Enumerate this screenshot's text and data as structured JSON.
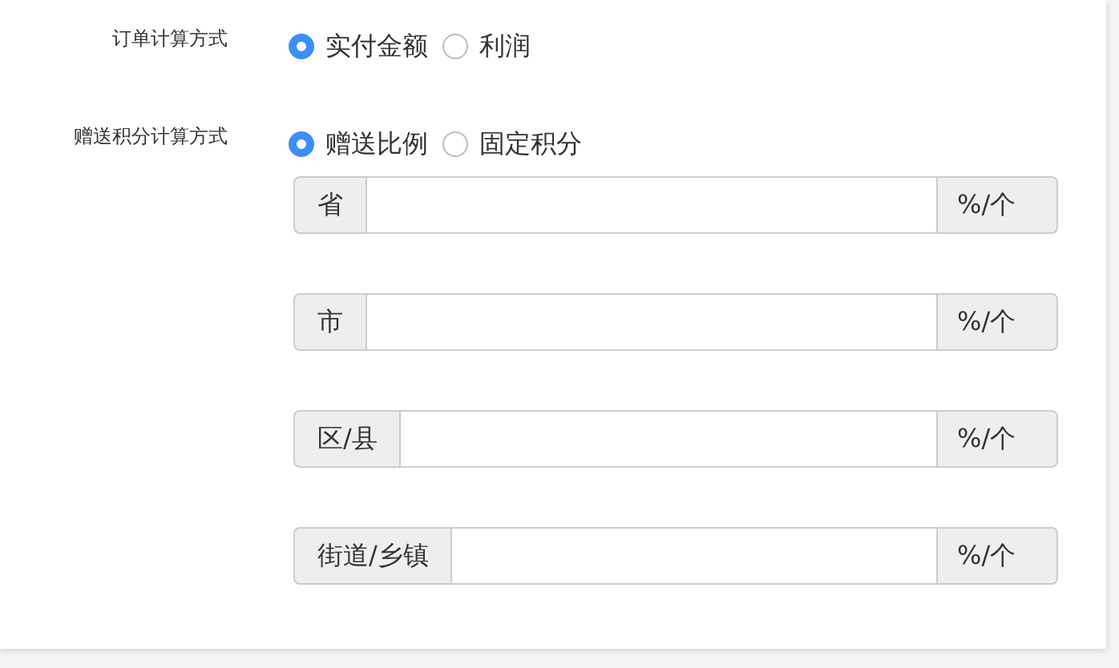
{
  "settings": [
    {
      "label": "订单计算方式",
      "options": [
        {
          "label": "实付金额",
          "selected": true
        },
        {
          "label": "利润",
          "selected": false
        }
      ]
    },
    {
      "label": "赠送积分计算方式",
      "options": [
        {
          "label": "赠送比例",
          "selected": true
        },
        {
          "label": "固定积分",
          "selected": false
        }
      ]
    }
  ],
  "rate_fields": [
    {
      "prefix": "省",
      "suffix": "%/个"
    },
    {
      "prefix": "市",
      "suffix": "%/个"
    },
    {
      "prefix": "区/县",
      "suffix": "%/个"
    },
    {
      "prefix": "街道/乡镇",
      "suffix": "%/个"
    }
  ]
}
